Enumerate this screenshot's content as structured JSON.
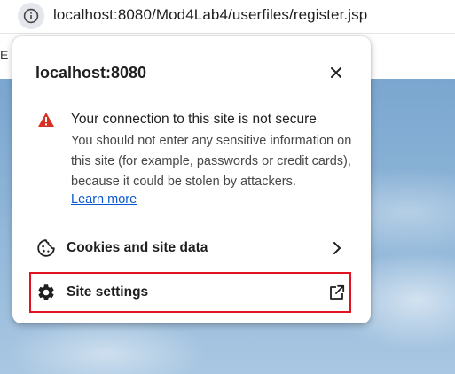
{
  "omnibox": {
    "url": "localhost:8080/Mod4Lab4/userfiles/register.jsp",
    "site_info_icon": "info-icon"
  },
  "page": {
    "fragment": "E L"
  },
  "popup": {
    "title": "localhost:8080",
    "close_icon": "close-icon",
    "security": {
      "icon": "warning-icon",
      "heading": "Your connection to this site is not secure",
      "body": "You should not enter any sensitive information on this site (for example, passwords or credit cards), because it could be stolen by attackers.",
      "learn_more": "Learn more"
    },
    "items": [
      {
        "label": "Cookies and site data",
        "icon": "cookie-icon",
        "trailing_icon": "chevron-right-icon"
      },
      {
        "label": "Site settings",
        "icon": "gear-icon",
        "trailing_icon": "open-external-icon"
      }
    ]
  },
  "colors": {
    "warning": "#d93025",
    "link": "#0b57d0",
    "highlight": "#e0141e"
  }
}
